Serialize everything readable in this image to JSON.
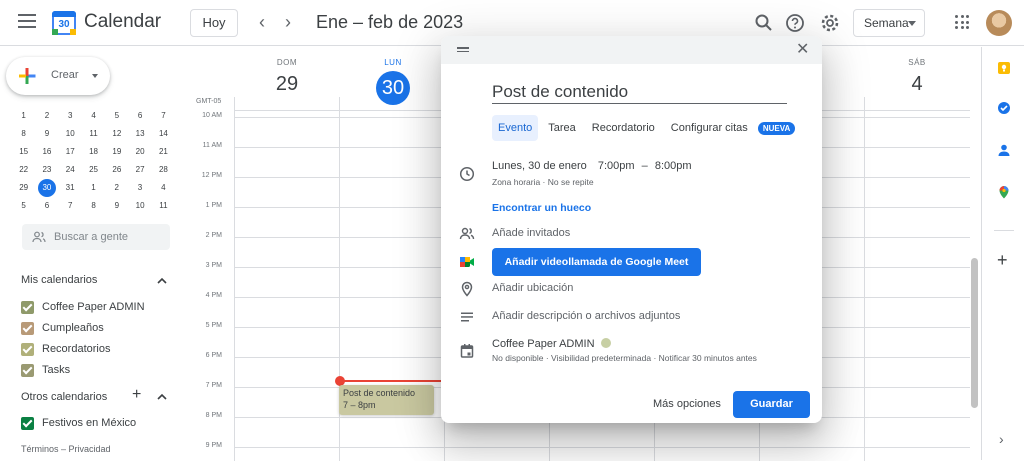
{
  "header": {
    "app_title": "Calendar",
    "logo_day": "30",
    "today_label": "Hoy",
    "date_range": "Ene – feb de 2023",
    "view_label": "Semana"
  },
  "sidebar": {
    "create_label": "Crear",
    "mini_calendar": [
      [
        "1",
        "2",
        "3",
        "4",
        "5",
        "6",
        "7"
      ],
      [
        "8",
        "9",
        "10",
        "11",
        "12",
        "13",
        "14"
      ],
      [
        "15",
        "16",
        "17",
        "18",
        "19",
        "20",
        "21"
      ],
      [
        "22",
        "23",
        "24",
        "25",
        "26",
        "27",
        "28"
      ],
      [
        "29",
        "30",
        "31",
        "1",
        "2",
        "3",
        "4"
      ],
      [
        "5",
        "6",
        "7",
        "8",
        "9",
        "10",
        "11"
      ]
    ],
    "mini_today": "30",
    "search_people_placeholder": "Buscar a gente",
    "my_calendars_title": "Mis calendarios",
    "my_calendars": [
      {
        "label": "Coffee Paper ADMIN",
        "color": "#8f9a6a"
      },
      {
        "label": "Cumpleaños",
        "color": "#b89a78"
      },
      {
        "label": "Recordatorios",
        "color": "#b0b07a"
      },
      {
        "label": "Tasks",
        "color": "#9a9a72"
      }
    ],
    "other_calendars_title": "Otros calendarios",
    "other_calendars": [
      {
        "label": "Festivos en México",
        "color": "#0b8043"
      }
    ],
    "footer": "Términos – Privacidad"
  },
  "grid": {
    "days": [
      {
        "name": "DOM",
        "num": "29"
      },
      {
        "name": "LUN",
        "num": "30",
        "today": true
      },
      {
        "name": "SÁB",
        "num": "4"
      }
    ],
    "timezone": "GMT-05",
    "hours": [
      "10 AM",
      "11 AM",
      "12 PM",
      "1 PM",
      "2 PM",
      "3 PM",
      "4 PM",
      "5 PM",
      "6 PM",
      "7 PM",
      "8 PM",
      "9 PM"
    ],
    "event": {
      "title": "Post de contenido",
      "time": "7 – 8pm"
    }
  },
  "dialog": {
    "title_value": "Post de contenido",
    "tabs": [
      "Evento",
      "Tarea",
      "Recordatorio",
      "Configurar citas"
    ],
    "new_badge": "NUEVA",
    "date_text": "Lunes, 30 de enero",
    "start_time": "7:00pm",
    "dash": "–",
    "end_time": "8:00pm",
    "date_sub": "Zona horaria · No se repite",
    "find_slot": "Encontrar un hueco",
    "add_guests": "Añade invitados",
    "meet_button": "Añadir videollamada de Google Meet",
    "add_location": "Añadir ubicación",
    "add_description": "Añadir descripción o archivos adjuntos",
    "calendar_name": "Coffee Paper ADMIN",
    "calendar_sub": "No disponible · Visibilidad predeterminada · Notificar 30 minutos antes",
    "more_options": "Más opciones",
    "save": "Guardar"
  },
  "colors": {
    "accent": "#1a73e8",
    "now_line": "#ea4335",
    "event_bg": "#c9c8a0"
  }
}
